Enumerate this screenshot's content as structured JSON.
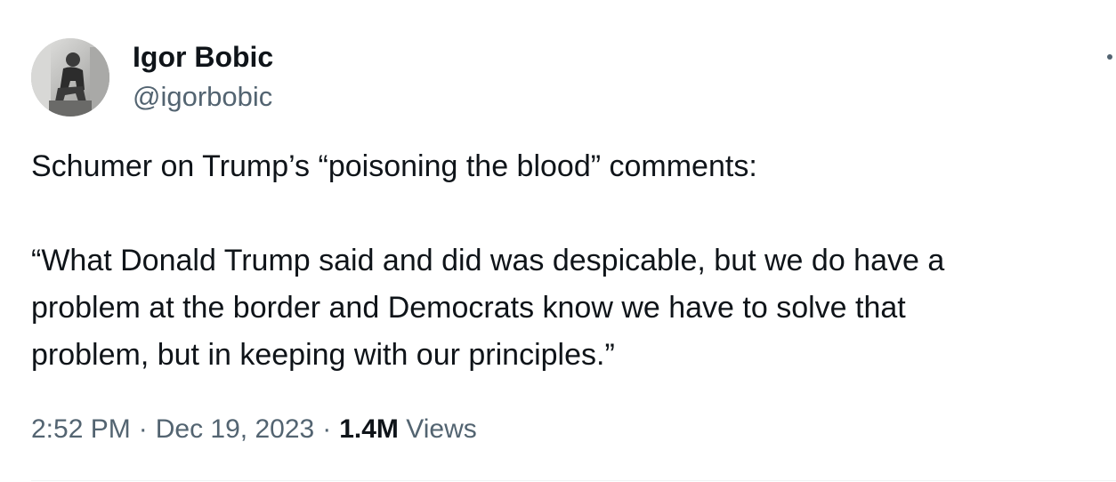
{
  "author": {
    "name": "Igor Bobic",
    "handle": "@igorbobic",
    "avatar_icon": "profile-photo"
  },
  "tweet": {
    "paragraph_1": "Schumer on Trump’s “poisoning the blood” comments:",
    "paragraph_2_lines": [
      "“What Donald Trump said and did was despicable, but we do have a",
      "problem at the border and Democrats know we have to solve that",
      "problem, but in keeping with our principles.”"
    ]
  },
  "meta": {
    "time": "2:52 PM",
    "date": "Dec 19, 2023",
    "separator": "·",
    "views_count": "1.4M",
    "views_label": "Views"
  },
  "colors": {
    "text_primary": "#0f1419",
    "text_secondary": "#536471",
    "divider": "#eff3f4"
  }
}
